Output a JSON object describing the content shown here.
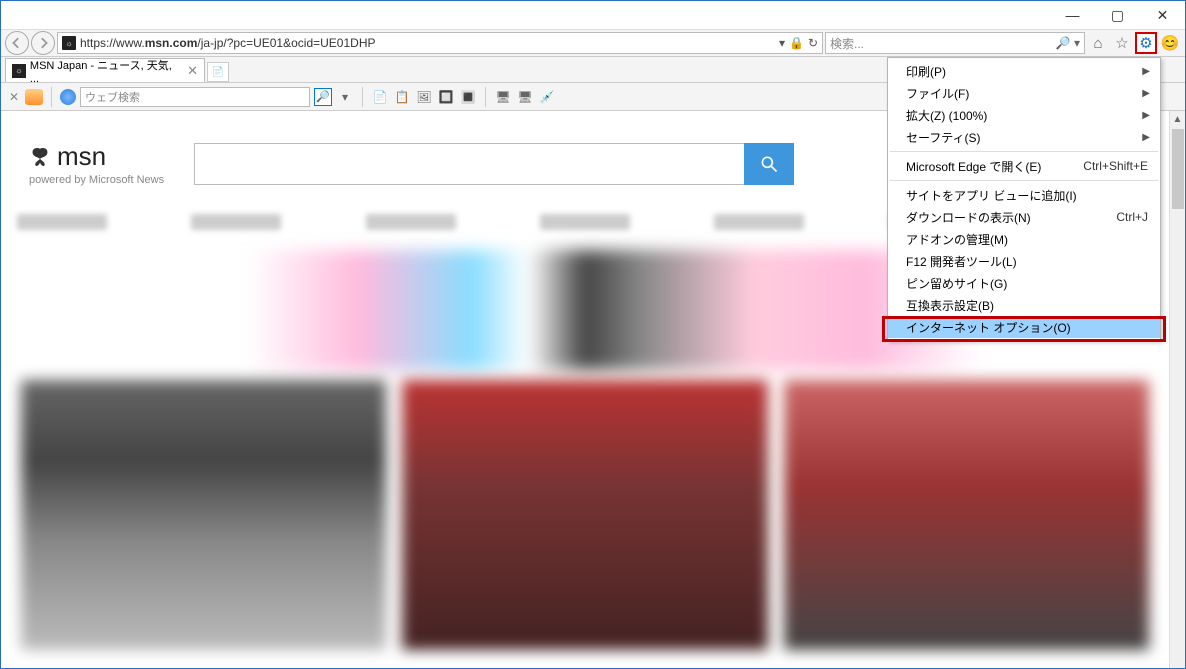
{
  "titlebar": {
    "min": "—",
    "max": "▢",
    "close": "✕"
  },
  "nav": {
    "back": "←",
    "fwd": "→"
  },
  "url": {
    "scheme": "https://",
    "host": "www.",
    "domain": "msn.com",
    "path": "/ja-jp/?pc=UE01&ocid=UE01DHP",
    "dropdown": "▾",
    "lock": "🔒",
    "refresh": "↻"
  },
  "search": {
    "placeholder": "検索...",
    "magnify": "🔎",
    "dropdown": "▾"
  },
  "chrome_icons": {
    "home": "⌂",
    "star": "☆",
    "gear": "⚙",
    "smile": "😊"
  },
  "tab": {
    "title": "MSN Japan - ニュース, 天気, ...",
    "close": "✕",
    "new": "+"
  },
  "toolbar": {
    "close": "✕",
    "search_placeholder": "ウェブ検索",
    "magnify": "🔎"
  },
  "msn": {
    "name": "msn",
    "tagline": "powered by Microsoft News",
    "search_icon": "🔍"
  },
  "menu": {
    "print": "印刷(P)",
    "file": "ファイル(F)",
    "zoom": "拡大(Z) (100%)",
    "safety": "セーフティ(S)",
    "edge_open": "Microsoft Edge で開く(E)",
    "edge_open_sc": "Ctrl+Shift+E",
    "add_app": "サイトをアプリ ビューに追加(I)",
    "downloads": "ダウンロードの表示(N)",
    "downloads_sc": "Ctrl+J",
    "addons": "アドオンの管理(M)",
    "f12": "F12 開発者ツール(L)",
    "pinned": "ピン留めサイト(G)",
    "compat": "互換表示設定(B)",
    "internet_options": "インターネット オプション(O)"
  }
}
